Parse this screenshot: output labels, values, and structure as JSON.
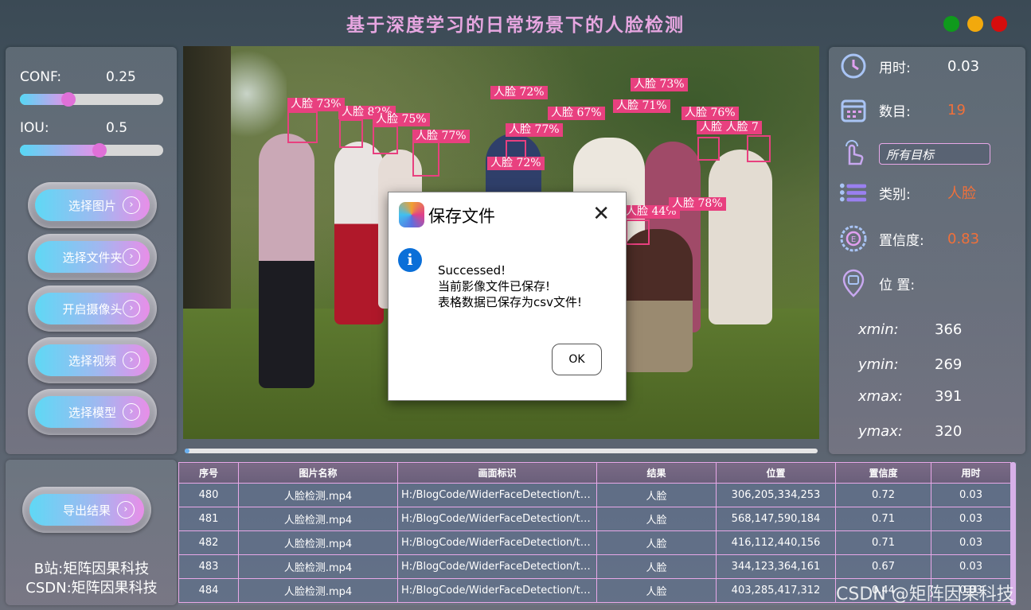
{
  "window": {
    "title": "基于深度学习的日常场景下的人脸检测",
    "colors": {
      "green": "#0f9a1c",
      "yellow": "#f2a90c",
      "red": "#d60d0d"
    }
  },
  "left_panel": {
    "conf_label": "CONF:",
    "conf_value": "0.25",
    "conf_level": 0.25,
    "iou_label": "IOU:",
    "iou_value": "0.5",
    "iou_level": 0.5,
    "buttons": [
      "选择图片",
      "选择文件夹",
      "开启摄像头",
      "选择视频",
      "选择模型"
    ],
    "chevron": "›"
  },
  "detections": [
    {
      "label": "人脸 73%"
    },
    {
      "label": "人脸 82%"
    },
    {
      "label": "人脸 75%"
    },
    {
      "label": "人脸 77%"
    },
    {
      "label": "人脸 72%"
    },
    {
      "label": "人脸 72%"
    },
    {
      "label": "人脸 67%"
    },
    {
      "label": "人脸 77%"
    },
    {
      "label": "人脸 73%"
    },
    {
      "label": "人脸 71%"
    },
    {
      "label": "人脸 76%"
    },
    {
      "label": "人脸 人脸 7"
    },
    {
      "label": "人脸 44%"
    },
    {
      "label": "人脸 78%"
    }
  ],
  "progress": {
    "fraction": 0.01
  },
  "right_panel": {
    "time_label": "用时:",
    "time_value": "0.03",
    "count_label": "数目:",
    "count_value": "19",
    "target_combo": "所有目标",
    "class_label": "类别:",
    "class_value": "人脸",
    "conf_label": "置信度:",
    "conf_value": "0.83",
    "position_label": "位 置:",
    "coords": [
      {
        "name": "xmin:",
        "value": "366"
      },
      {
        "name": "ymin:",
        "value": "269"
      },
      {
        "name": "xmax:",
        "value": "391"
      },
      {
        "name": "ymax:",
        "value": "320"
      }
    ],
    "accent_color": "#f0703a"
  },
  "dialog": {
    "title": "保存文件",
    "close": "✕",
    "info_glyph": "i",
    "line1": "Successed!",
    "line2": "当前影像文件已保存!",
    "line3": "表格数据已保存为csv文件!",
    "ok": "OK"
  },
  "bottom_left": {
    "export_button": "导出结果",
    "credit_bili": "B站:矩阵因果科技",
    "credit_csdn": "CSDN:矩阵因果科技"
  },
  "table": {
    "headers": [
      "序号",
      "图片名称",
      "画面标识",
      "结果",
      "位置",
      "置信度",
      "用时"
    ],
    "rows": [
      [
        "480",
        "人脸检测.mp4",
        "H:/BlogCode/WiderFaceDetection/te...",
        "人脸",
        "306,205,334,253",
        "0.72",
        "0.03"
      ],
      [
        "481",
        "人脸检测.mp4",
        "H:/BlogCode/WiderFaceDetection/te...",
        "人脸",
        "568,147,590,184",
        "0.71",
        "0.03"
      ],
      [
        "482",
        "人脸检测.mp4",
        "H:/BlogCode/WiderFaceDetection/te...",
        "人脸",
        "416,112,440,156",
        "0.71",
        "0.03"
      ],
      [
        "483",
        "人脸检测.mp4",
        "H:/BlogCode/WiderFaceDetection/te...",
        "人脸",
        "344,123,364,161",
        "0.67",
        "0.03"
      ],
      [
        "484",
        "人脸检测.mp4",
        "H:/BlogCode/WiderFaceDetection/te...",
        "人脸",
        "403,285,417,312",
        "0.44",
        "0.03"
      ]
    ]
  },
  "watermark": "CSDN @矩阵因果科技"
}
